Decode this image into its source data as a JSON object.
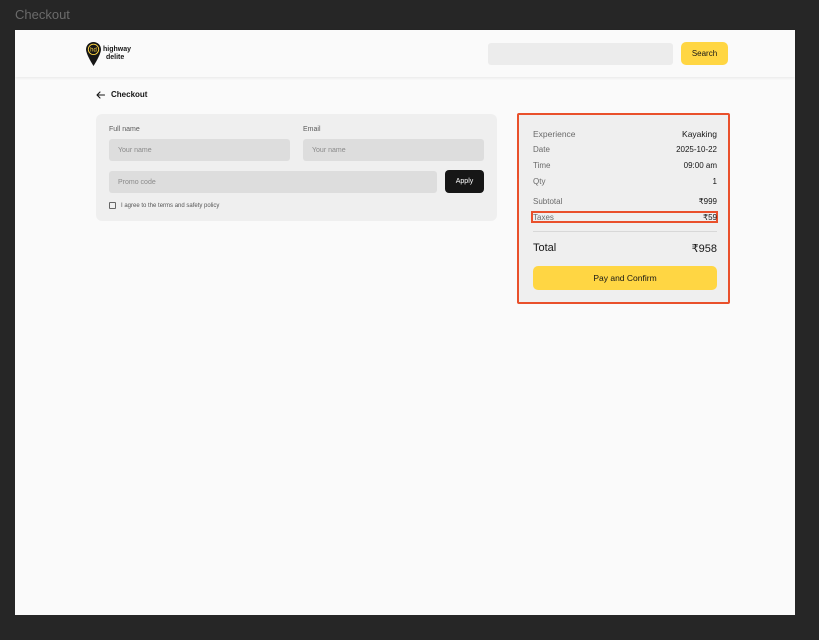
{
  "window": {
    "title": "Checkout"
  },
  "header": {
    "logo": {
      "mark": "hd",
      "line1": "highway",
      "line2": "delite"
    },
    "search": {
      "placeholder": "",
      "button_label": "Search"
    }
  },
  "back": {
    "label": "Checkout"
  },
  "form": {
    "full_name": {
      "label": "Full name",
      "placeholder": "Your name"
    },
    "email": {
      "label": "Email",
      "placeholder": "Your name"
    },
    "promo": {
      "placeholder": "Promo code",
      "button_label": "Apply"
    },
    "agree": {
      "label": "I agree to the terms and safety policy",
      "checked": false
    }
  },
  "summary": {
    "rows": [
      {
        "label": "Experience",
        "value": "Kayaking"
      },
      {
        "label": "Date",
        "value": "2025-10-22"
      },
      {
        "label": "Time",
        "value": "09:00 am"
      },
      {
        "label": "Qty",
        "value": "1"
      },
      {
        "label": "Subtotal",
        "value": "₹999"
      },
      {
        "label": "Taxes",
        "value": "₹59"
      }
    ],
    "total": {
      "label": "Total",
      "value": "₹958"
    },
    "pay_button_label": "Pay and Confirm"
  },
  "colors": {
    "accent": "#ffd643",
    "highlight": "#e9502b",
    "dark": "#161616"
  }
}
